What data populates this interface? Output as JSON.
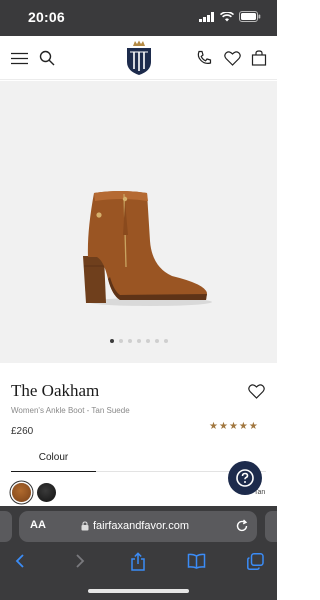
{
  "status_bar": {
    "time": "20:06"
  },
  "header": {
    "icons": [
      "menu-icon",
      "search-icon",
      "phone-icon",
      "heart-icon",
      "bag-icon"
    ],
    "logo": "brand-shield-logo"
  },
  "gallery": {
    "slide_count": 7,
    "active_slide": 1
  },
  "product": {
    "title": "The Oakham",
    "subtitle": "Women's Ankle Boot - Tan Suede",
    "price": "£260",
    "rating": 5,
    "rating_color": "#a1773f"
  },
  "options": {
    "tab_label": "Colour",
    "swatches": [
      {
        "name": "tan",
        "selected": true,
        "color": "#96501f"
      },
      {
        "name": "black",
        "selected": false,
        "color": "#1a1a1a"
      }
    ],
    "swatch_label_fragment": "Tan"
  },
  "help": {
    "icon": "question-icon",
    "color": "#1d2b4c"
  },
  "browser": {
    "aa_label": "AA",
    "url": "fairfaxandfavor.com",
    "toolbar_icons": [
      "back-icon",
      "forward-icon",
      "share-icon",
      "bookmarks-icon",
      "tabs-icon"
    ],
    "accent": "#3b8cf7"
  }
}
